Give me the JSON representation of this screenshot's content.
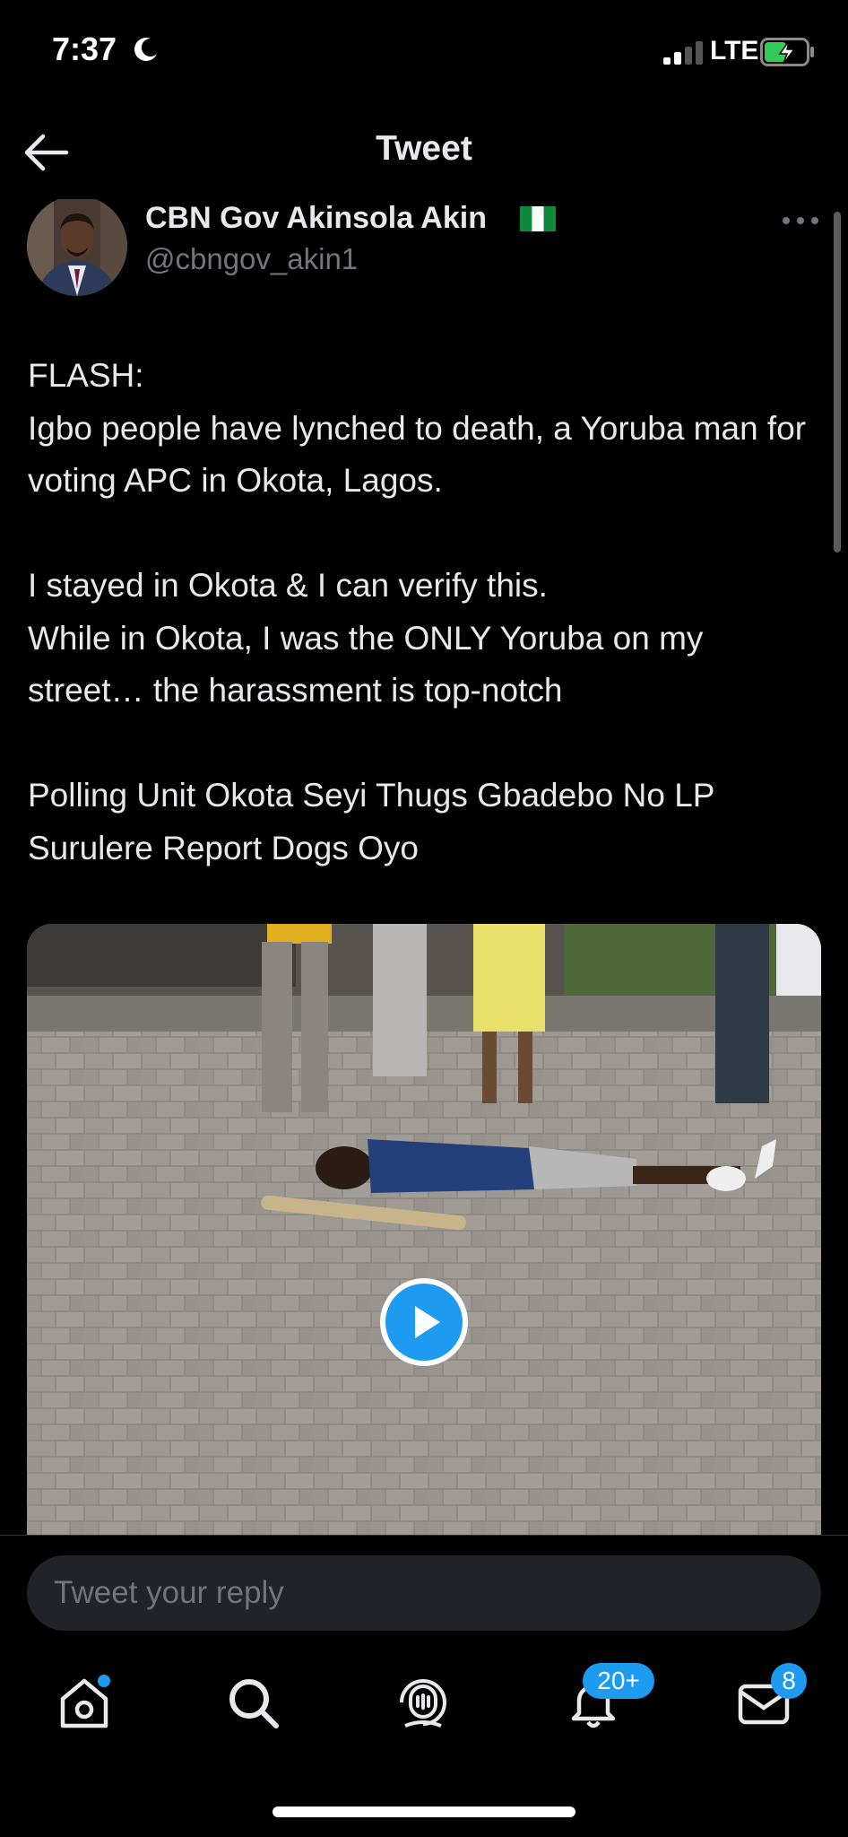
{
  "status_bar": {
    "time": "7:37",
    "network": "LTE",
    "icons": [
      "moon-icon",
      "signal-icon",
      "battery-charging-icon"
    ]
  },
  "nav": {
    "title": "Tweet",
    "back_icon": "arrow-left-icon"
  },
  "tweet": {
    "author_name": "CBN Gov Akinsola Akin",
    "author_handle": "@cbngov_akin1",
    "verified_flag_icon": "nigeria-flag-icon",
    "more_icon": "more-horizontal-icon",
    "text": {
      "line_flash": "FLASH:",
      "para1": "Igbo people have lynched to death, a Yoruba man for voting APC in Okota, Lagos.",
      "para2_line1": "I stayed in Okota & I can verify this.",
      "para2_line2": "While in Okota, I was the ONLY Yoruba on my street… the harassment is top-notch",
      "para3": "Polling Unit Okota Seyi Thugs Gbadebo No LP Surulere Report Dogs Oyo"
    },
    "media": {
      "type": "video",
      "play_icon": "play-icon"
    }
  },
  "reply": {
    "placeholder": "Tweet your reply"
  },
  "tab_bar": {
    "items": [
      {
        "name": "home",
        "icon": "home-icon",
        "has_dot": true
      },
      {
        "name": "search",
        "icon": "search-icon"
      },
      {
        "name": "spaces",
        "icon": "spaces-icon"
      },
      {
        "name": "notifications",
        "icon": "bell-icon",
        "badge": "20+"
      },
      {
        "name": "messages",
        "icon": "mail-icon",
        "badge": "8"
      }
    ]
  },
  "colors": {
    "accent": "#1d9bf0",
    "background": "#000000",
    "text_primary": "#e7e9ea",
    "text_secondary": "#71767b"
  }
}
